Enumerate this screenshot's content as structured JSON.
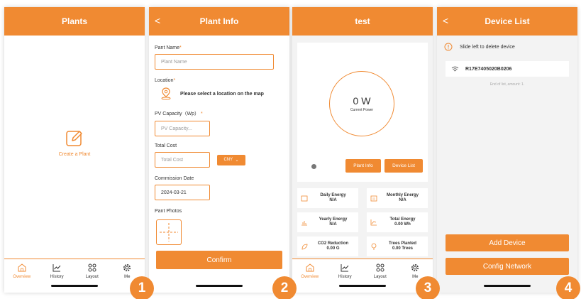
{
  "colors": {
    "accent": "#f08a32"
  },
  "screen1": {
    "title": "Plants",
    "create_label": "Create a Plant",
    "tabs": [
      {
        "label": "Overview",
        "icon": "home-icon",
        "active": true
      },
      {
        "label": "History",
        "icon": "chart-icon"
      },
      {
        "label": "Layout",
        "icon": "grid-icon"
      },
      {
        "label": "Me",
        "icon": "gear-icon"
      }
    ],
    "step": "1"
  },
  "screen2": {
    "back": "<",
    "title": "Plant Info",
    "plant_name_label": "Pant Name",
    "plant_name_placeholder": "Plant Name",
    "location_label": "Location",
    "location_text": "Please select a location on the map",
    "pv_label": "PV Capacity（Wp）",
    "pv_placeholder": "PV Capacity...",
    "cost_label": "Total Cost",
    "cost_placeholder": "Total Cost",
    "currency": "CNY",
    "commission_label": "Commission Date",
    "commission_value": "2024-03-21",
    "photos_label": "Pant Photos",
    "confirm": "Confirm",
    "required_mark": "*",
    "step": "2"
  },
  "screen3": {
    "title": "test",
    "power_value": "0 W",
    "power_label": "Current Power",
    "plant_info_btn": "Plant Info",
    "device_list_btn": "Device List",
    "metrics": [
      {
        "label": "Daily Energy",
        "value": "N/A"
      },
      {
        "label": "Monthly Energy",
        "value": "N/A"
      },
      {
        "label": "Yearly Energy",
        "value": "N/A"
      },
      {
        "label": "Total Energy",
        "value": "0.00 Wh"
      },
      {
        "label": "CO2 Reduction",
        "value": "0.00 G"
      },
      {
        "label": "Trees Planted",
        "value": "0.00 Trees"
      }
    ],
    "tabs": [
      {
        "label": "Overview",
        "active": true
      },
      {
        "label": "History"
      },
      {
        "label": "Layout"
      },
      {
        "label": "Me"
      }
    ],
    "step": "3"
  },
  "screen4": {
    "back": "<",
    "title": "Device List",
    "hint": "Slide left to delete device",
    "device_name": "R17E7405020B0206",
    "end_text": "End of list, amount: 1.",
    "add_device": "Add Device",
    "config_network": "Config Network",
    "step": "4"
  }
}
